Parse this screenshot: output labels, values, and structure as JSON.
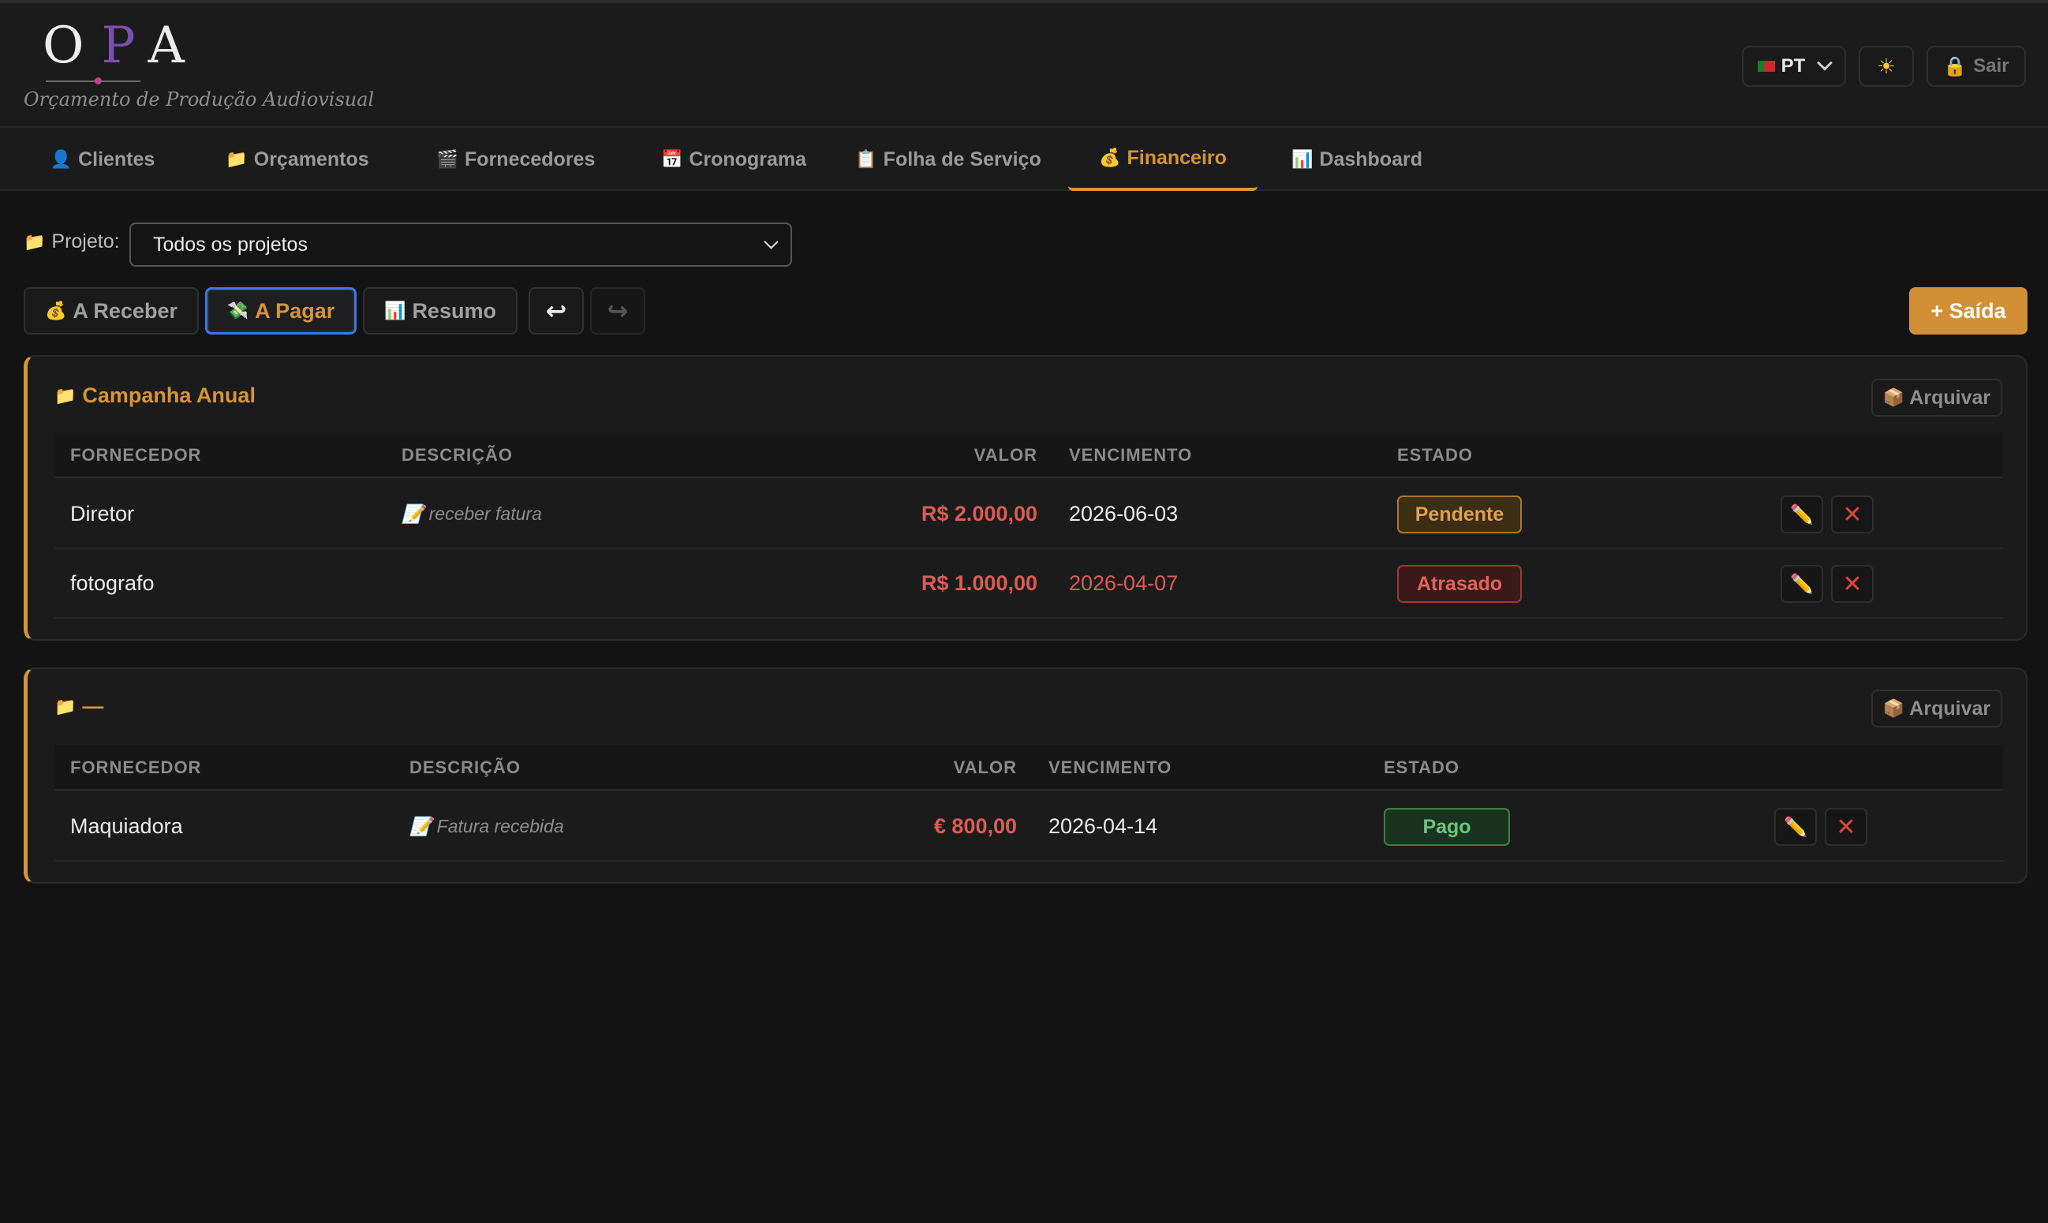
{
  "app": {
    "logo_letters": [
      "O",
      "P",
      "A"
    ],
    "logo_subtitle": "Orçamento de Produção Audiovisual"
  },
  "header": {
    "lang_label": "PT",
    "theme_icon": "sun-icon",
    "logout_label": "Sair",
    "logout_icon": "lock-icon"
  },
  "nav": {
    "tabs": [
      {
        "icon": "👤",
        "label": "Clientes"
      },
      {
        "icon": "📁",
        "label": "Orçamentos"
      },
      {
        "icon": "🎬",
        "label": "Fornecedores"
      },
      {
        "icon": "📅",
        "label": "Cronograma"
      },
      {
        "icon": "📋",
        "label": "Folha de Serviço"
      },
      {
        "icon": "💰",
        "label": "Financeiro"
      },
      {
        "icon": "📊",
        "label": "Dashboard"
      }
    ],
    "active_tab": "Financeiro"
  },
  "filter": {
    "project_icon": "📁",
    "project_label": "Projeto:",
    "project_value": "Todos os projetos"
  },
  "toolbar": {
    "receber_icon": "💰",
    "receber_label": "A Receber",
    "pagar_icon": "💸",
    "pagar_label": "A Pagar",
    "resumo_icon": "📊",
    "resumo_label": "Resumo",
    "undo_glyph": "↩",
    "redo_glyph": "↪",
    "new_expense_label": "+ Saída"
  },
  "columns": {
    "fornecedor": "FORNECEDOR",
    "descricao": "DESCRIÇÃO",
    "valor": "VALOR",
    "vencimento": "VENCIMENTO",
    "estado": "ESTADO"
  },
  "groups": [
    {
      "icon": "📁",
      "title": "Campanha Anual",
      "archive_icon": "📦",
      "archive_label": "Arquivar",
      "rows": [
        {
          "fornecedor": "Diretor",
          "descricao": "receber fatura",
          "desc_icon": "📝",
          "valor": "R$ 2.000,00",
          "vencimento": "2026-06-03",
          "vencimento_late": false,
          "estado": "Pendente"
        },
        {
          "fornecedor": "fotografo",
          "descricao": "",
          "desc_icon": "",
          "valor": "R$ 1.000,00",
          "vencimento": "2026-04-07",
          "vencimento_late": true,
          "estado": "Atrasado"
        }
      ]
    },
    {
      "icon": "📁",
      "title": "—",
      "archive_icon": "📦",
      "archive_label": "Arquivar",
      "rows": [
        {
          "fornecedor": "Maquiadora",
          "descricao": "Fatura recebida",
          "desc_icon": "📝",
          "valor": "€ 800,00",
          "vencimento": "2026-04-14",
          "vencimento_late": false,
          "estado": "Pago"
        }
      ]
    }
  ],
  "row_actions": {
    "edit_icon": "✏️",
    "delete_icon": "✕"
  },
  "colors": {
    "accent": "#d59536",
    "background": "#131313",
    "surface": "#1b1b1c",
    "danger": "#dc5b53",
    "success": "#69c77a",
    "focus": "#3b79e0"
  }
}
